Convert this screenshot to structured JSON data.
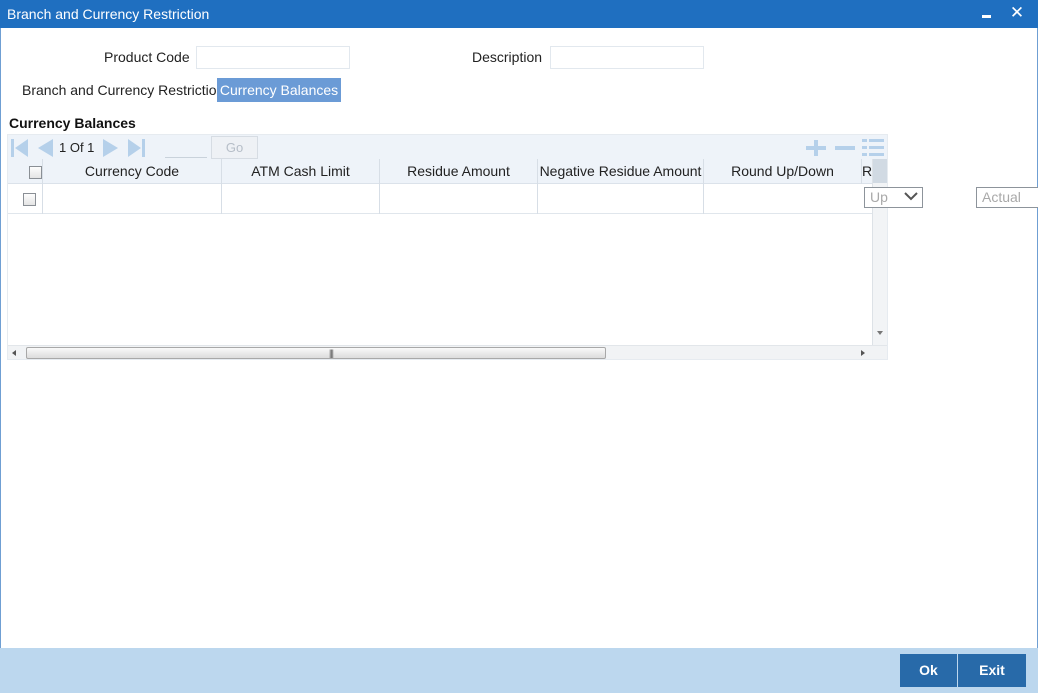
{
  "window": {
    "title": "Branch and Currency Restriction"
  },
  "form": {
    "product_code_label": "Product Code",
    "product_code_value": "",
    "description_label": "Description",
    "description_value": ""
  },
  "tabs": [
    {
      "label": "Branch and Currency Restriction",
      "active": false
    },
    {
      "label": "Currency Balances",
      "active": true
    }
  ],
  "section": {
    "title": "Currency Balances"
  },
  "grid": {
    "pager": {
      "text": "1 Of 1",
      "go_label": "Go",
      "page_input": ""
    },
    "columns": [
      "Currency Code",
      "ATM Cash Limit",
      "Residue Amount",
      "Negative Residue Amount",
      "Round Up/Down",
      "R"
    ],
    "rows": [
      {
        "currency_code": "",
        "atm_cash_limit": "",
        "residue_amount": "",
        "negative_residue_amount": "",
        "round_up_down": "Up",
        "extra": "Actual"
      }
    ]
  },
  "footer": {
    "ok_label": "Ok",
    "exit_label": "Exit"
  },
  "colors": {
    "title_bar": "#1f6fc0",
    "active_tab": "#6b9bd6",
    "footer_bg": "#bcd7ee",
    "button": "#286aa9",
    "nav_icon": "#b5d0ea"
  }
}
